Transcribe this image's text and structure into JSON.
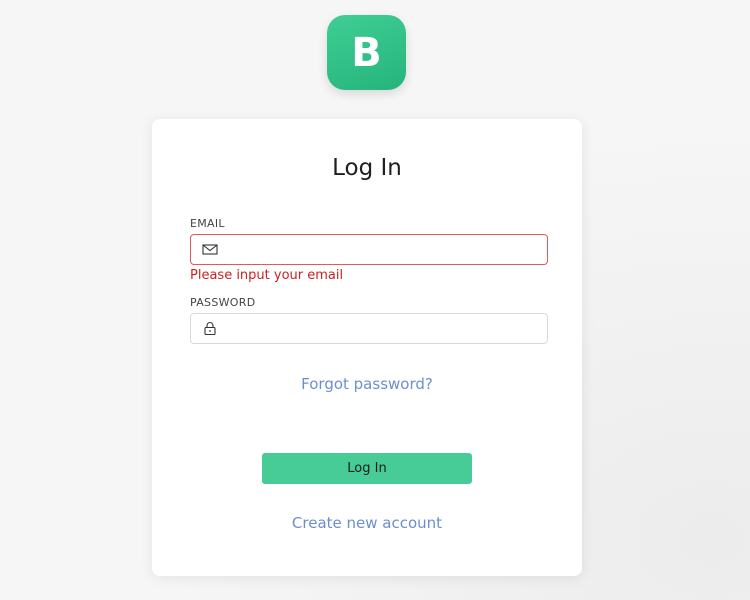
{
  "logo": {
    "letter": "B",
    "color": "#32c08a"
  },
  "form": {
    "title": "Log In",
    "email": {
      "label": "EMAIL",
      "value": "",
      "placeholder": "",
      "icon": "mail-icon",
      "error": "Please input your email"
    },
    "password": {
      "label": "PASSWORD",
      "value": "",
      "placeholder": "",
      "icon": "lock-icon"
    },
    "forgot_link": "Forgot password?",
    "submit_label": "Log In",
    "create_link": "Create new account"
  },
  "colors": {
    "accent": "#48cc97",
    "error": "#cc2020",
    "link": "#6b8fce"
  }
}
